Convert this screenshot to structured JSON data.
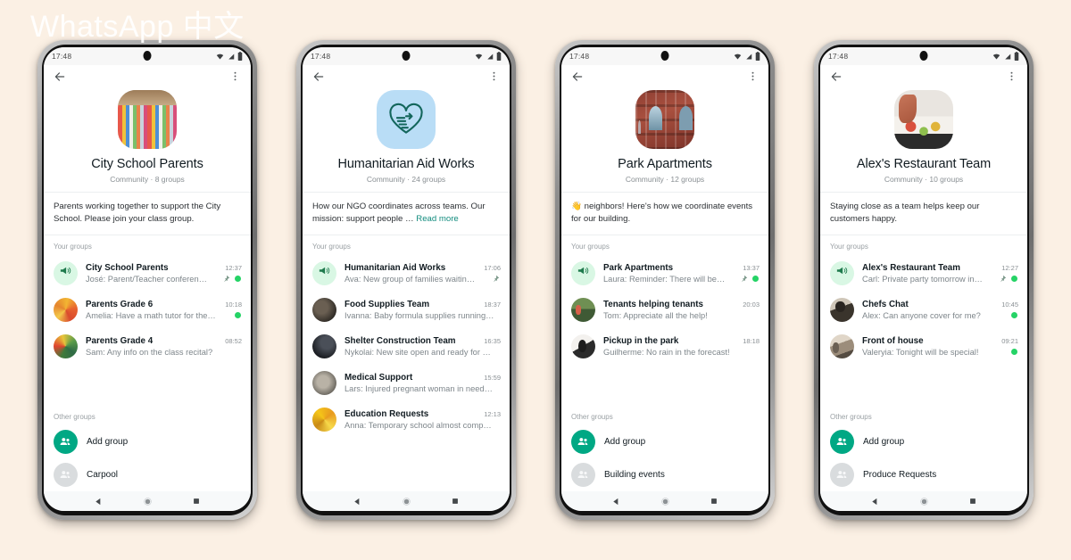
{
  "watermark": "WhatsApp 中文",
  "colors": {
    "background": "#fbf0e4",
    "accent_green": "#00a884",
    "unread_dot": "#25d366",
    "link": "#128c7e",
    "announce_bg": "#d9f7e4"
  },
  "labels": {
    "your_groups": "Your groups",
    "other_groups": "Other groups",
    "add_group": "Add group",
    "read_more": "Read more"
  },
  "icons": {
    "back": "back-arrow-icon",
    "menu": "overflow-menu-icon",
    "wifi": "wifi-icon",
    "signal": "signal-icon",
    "battery": "battery-icon",
    "announcement": "megaphone-icon",
    "pin": "pin-icon",
    "nav_back": "nav-back-triangle-icon",
    "nav_home": "nav-home-circle-icon",
    "nav_recents": "nav-recents-square-icon"
  },
  "phones": [
    {
      "status_time": "17:48",
      "avatar_style": "ph-books",
      "community_name": "City School Parents",
      "community_meta": "Community · 8 groups",
      "description": "Parents working together to support the City School. Please join your class group.",
      "description_truncated": false,
      "your_groups": [
        {
          "avatar_style": "announce",
          "title": "City School Parents",
          "time": "12:37",
          "preview": "José: Parent/Teacher conferen…",
          "pinned": true,
          "unread": true
        },
        {
          "avatar_style": "ph-warm",
          "title": "Parents Grade 6",
          "time": "10:18",
          "preview": "Amelia: Have a math tutor for the…",
          "pinned": false,
          "unread": true
        },
        {
          "avatar_style": "ph-green",
          "title": "Parents Grade 4",
          "time": "08:52",
          "preview": "Sam: Any info on the class recital?",
          "pinned": false,
          "unread": false
        }
      ],
      "other_groups": [
        {
          "label": "Carpool"
        }
      ]
    },
    {
      "status_time": "17:48",
      "avatar_style": "ph-ngo",
      "community_name": "Humanitarian Aid Works",
      "community_meta": "Community · 24 groups",
      "description": "How our NGO coordinates across teams. Our mission: support people …",
      "description_truncated": true,
      "your_groups": [
        {
          "avatar_style": "announce",
          "title": "Humanitarian Aid Works",
          "time": "17:06",
          "preview": "Ava: New group of families waitin…",
          "pinned": true,
          "unread": false
        },
        {
          "avatar_style": "ph-dark",
          "title": "Food Supplies Team",
          "time": "18:37",
          "preview": "Ivanna: Baby formula supplies running …",
          "pinned": false,
          "unread": false
        },
        {
          "avatar_style": "ph-night",
          "title": "Shelter Construction Team",
          "time": "16:35",
          "preview": "Nykolai: New site open and ready for …",
          "pinned": false,
          "unread": false
        },
        {
          "avatar_style": "ph-grey",
          "title": "Medical Support",
          "time": "15:59",
          "preview": "Lars: Injured pregnant woman in need…",
          "pinned": false,
          "unread": false
        },
        {
          "avatar_style": "ph-yellow",
          "title": "Education Requests",
          "time": "12:13",
          "preview": "Anna: Temporary school almost comp…",
          "pinned": false,
          "unread": false
        }
      ],
      "other_groups": []
    },
    {
      "status_time": "17:48",
      "avatar_style": "ph-building",
      "community_name": "Park Apartments",
      "community_meta": "Community · 12 groups",
      "description": "👋 neighbors! Here's how we coordinate events for our building.",
      "description_truncated": false,
      "your_groups": [
        {
          "avatar_style": "announce",
          "title": "Park Apartments",
          "time": "13:37",
          "preview": "Laura: Reminder: There will be…",
          "pinned": true,
          "unread": true
        },
        {
          "avatar_style": "ph-park",
          "title": "Tenants helping tenants",
          "time": "20:03",
          "preview": "Tom: Appreciate all the help!",
          "pinned": false,
          "unread": false
        },
        {
          "avatar_style": "ph-bw",
          "title": "Pickup in the park",
          "time": "18:18",
          "preview": "Guilherme: No rain in the forecast!",
          "pinned": false,
          "unread": false
        }
      ],
      "other_groups": [
        {
          "label": "Building events"
        }
      ]
    },
    {
      "status_time": "17:48",
      "avatar_style": "ph-food",
      "community_name": "Alex's Restaurant Team",
      "community_meta": "Community · 10 groups",
      "description": "Staying close as a team helps keep our customers happy.",
      "description_truncated": false,
      "your_groups": [
        {
          "avatar_style": "announce",
          "title": "Alex's Restaurant Team",
          "time": "12:27",
          "preview": "Carl: Private party tomorrow in…",
          "pinned": true,
          "unread": true
        },
        {
          "avatar_style": "ph-chef",
          "title": "Chefs Chat",
          "time": "10:45",
          "preview": "Alex: Can anyone cover for me?",
          "pinned": false,
          "unread": true
        },
        {
          "avatar_style": "ph-house",
          "title": "Front of house",
          "time": "09:21",
          "preview": "Valeryia:  Tonight will be special!",
          "pinned": false,
          "unread": true
        }
      ],
      "other_groups": [
        {
          "label": "Produce Requests"
        }
      ]
    }
  ]
}
